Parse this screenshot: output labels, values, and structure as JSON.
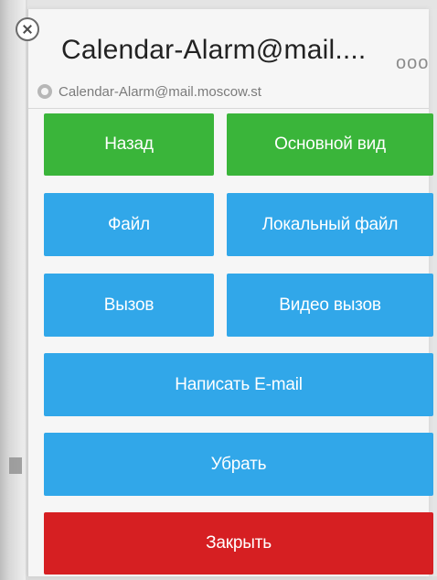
{
  "header": {
    "title": "Calendar-Alarm@mail....",
    "subtitle": "Calendar-Alarm@mail.moscow.st",
    "more_label": "ooo",
    "close_icon": "close-circle-icon",
    "subtitle_icon": "contact-icon"
  },
  "buttons": {
    "back": "Назад",
    "main_view": "Основной вид",
    "file": "Файл",
    "local_file": "Локальный файл",
    "call": "Вызов",
    "video_call": "Видео вызов",
    "email": "Написать E-mail",
    "remove": "Убрать",
    "close": "Закрыть"
  },
  "colors": {
    "green": "#3ab53a",
    "blue": "#31a7e9",
    "red": "#d61f22"
  }
}
